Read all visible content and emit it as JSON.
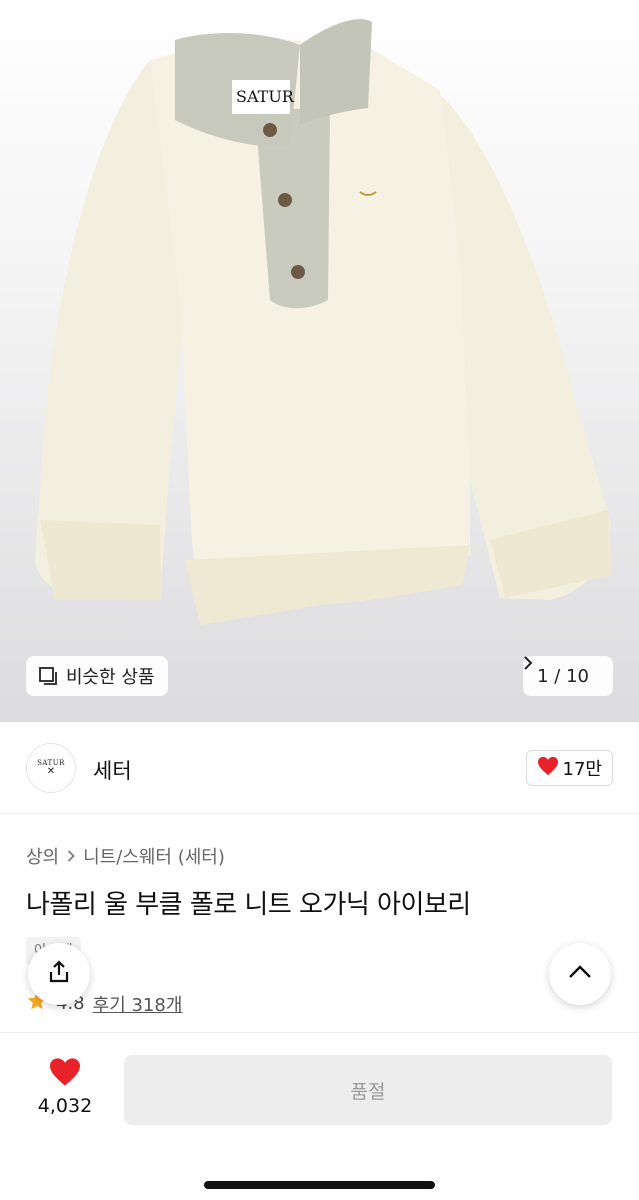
{
  "hero": {
    "brand_label": "SATUR",
    "similar_button_label": "비슷한 상품",
    "image_counter": "1 / 10"
  },
  "shop": {
    "logo_text": "SATUR",
    "logo_mark": "✕",
    "name": "세터",
    "like_count": "17만"
  },
  "product": {
    "breadcrumb": [
      "상의",
      "니트/스웨터 (세터)"
    ],
    "title": "나폴리 울 부클 폴로 니트 오가닉 아이보리",
    "tag": "아오레",
    "rating": "4.8",
    "review_link": "후기 318개"
  },
  "bottom": {
    "wish_count": "4,032",
    "buy_label": "품절"
  },
  "colors": {
    "heart": "#e8212b",
    "star": "#f5a623",
    "sweater": "#f5f1e2",
    "collar": "#c9cbbf"
  },
  "icons": [
    "similar-icon",
    "chevron-right-icon",
    "heart-icon",
    "share-icon",
    "chevron-up-icon",
    "star-icon"
  ]
}
